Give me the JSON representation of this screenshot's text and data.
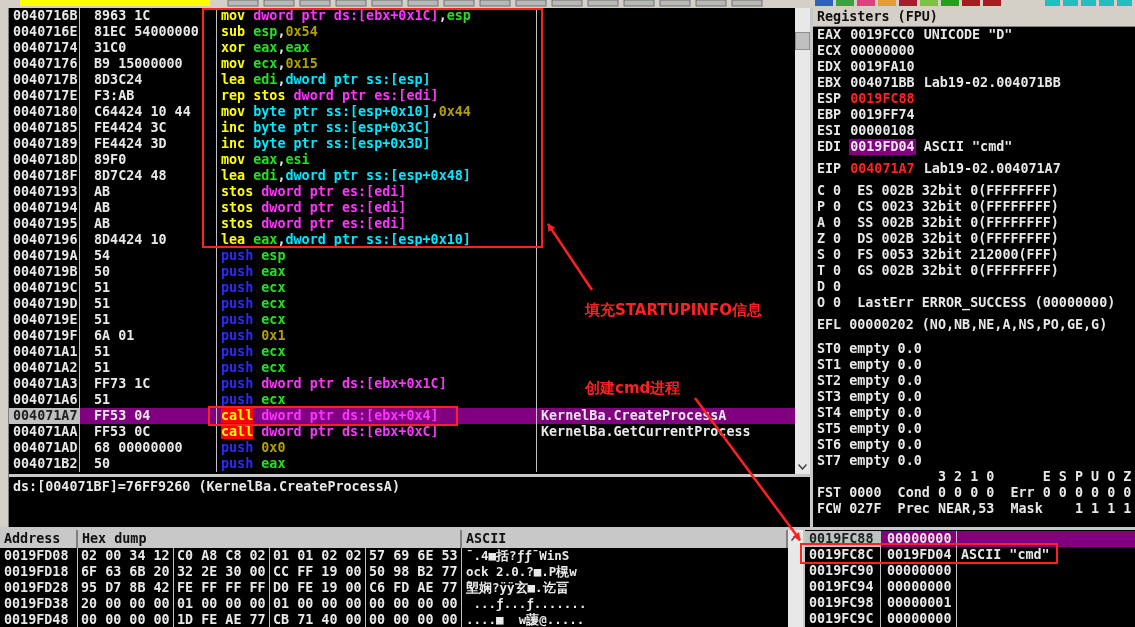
{
  "disassembly": {
    "rows": [
      {
        "address": "0040716B",
        "hex": "8963 1C",
        "op": "mov",
        "kind": "instruction",
        "operands": [
          {
            "text": "dword ptr ds:[ebx+0x1C]",
            "kind": "memory_ds_es"
          },
          {
            "text": ",",
            "kind": "separator"
          },
          {
            "text": "esp",
            "kind": "register"
          }
        ],
        "selected": false
      },
      {
        "address": "0040716E",
        "hex": "81EC 54000000",
        "op": "sub",
        "kind": "instruction",
        "operands": [
          {
            "text": "esp",
            "kind": "register"
          },
          {
            "text": ",",
            "kind": "separator"
          },
          {
            "text": "0x54",
            "kind": "constant"
          }
        ],
        "selected": false
      },
      {
        "address": "00407174",
        "hex": "31C0",
        "op": "xor",
        "kind": "instruction",
        "operands": [
          {
            "text": "eax",
            "kind": "register"
          },
          {
            "text": ",",
            "kind": "separator"
          },
          {
            "text": "eax",
            "kind": "register"
          }
        ],
        "selected": false
      },
      {
        "address": "00407176",
        "hex": "B9 15000000",
        "op": "mov",
        "kind": "instruction",
        "operands": [
          {
            "text": "ecx",
            "kind": "register"
          },
          {
            "text": ",",
            "kind": "separator"
          },
          {
            "text": "0x15",
            "kind": "constant"
          }
        ],
        "selected": false
      },
      {
        "address": "0040717B",
        "hex": "8D3C24",
        "op": "lea",
        "kind": "instruction",
        "operands": [
          {
            "text": "edi",
            "kind": "register"
          },
          {
            "text": ",",
            "kind": "separator"
          },
          {
            "text": "dword ptr ss:[esp]",
            "kind": "memory_ss"
          }
        ],
        "selected": false
      },
      {
        "address": "0040717E",
        "hex": "F3:AB",
        "op": "rep stos",
        "kind": "instruction",
        "operands": [
          {
            "text": "dword ptr es:[edi]",
            "kind": "memory_ds_es"
          }
        ],
        "selected": false
      },
      {
        "address": "00407180",
        "hex": "C64424 10 44",
        "op": "mov",
        "kind": "instruction",
        "operands": [
          {
            "text": "byte ptr ss:[esp+0x10]",
            "kind": "memory_ss"
          },
          {
            "text": ",",
            "kind": "separator"
          },
          {
            "text": "0x44",
            "kind": "constant"
          }
        ],
        "selected": false
      },
      {
        "address": "00407185",
        "hex": "FE4424 3C",
        "op": "inc",
        "kind": "instruction",
        "operands": [
          {
            "text": "byte ptr ss:[esp+0x3C]",
            "kind": "memory_ss"
          }
        ],
        "selected": false
      },
      {
        "address": "00407189",
        "hex": "FE4424 3D",
        "op": "inc",
        "kind": "instruction",
        "operands": [
          {
            "text": "byte ptr ss:[esp+0x3D]",
            "kind": "memory_ss"
          }
        ],
        "selected": false
      },
      {
        "address": "0040718D",
        "hex": "89F0",
        "op": "mov",
        "kind": "instruction",
        "operands": [
          {
            "text": "eax",
            "kind": "register"
          },
          {
            "text": ",",
            "kind": "separator"
          },
          {
            "text": "esi",
            "kind": "register"
          }
        ],
        "selected": false
      },
      {
        "address": "0040718F",
        "hex": "8D7C24 48",
        "op": "lea",
        "kind": "instruction",
        "operands": [
          {
            "text": "edi",
            "kind": "register"
          },
          {
            "text": ",",
            "kind": "separator"
          },
          {
            "text": "dword ptr ss:[esp+0x48]",
            "kind": "memory_ss"
          }
        ],
        "selected": false
      },
      {
        "address": "00407193",
        "hex": "AB",
        "op": "stos",
        "kind": "instruction",
        "operands": [
          {
            "text": "dword ptr es:[edi]",
            "kind": "memory_ds_es"
          }
        ],
        "selected": false
      },
      {
        "address": "00407194",
        "hex": "AB",
        "op": "stos",
        "kind": "instruction",
        "operands": [
          {
            "text": "dword ptr es:[edi]",
            "kind": "memory_ds_es"
          }
        ],
        "selected": false
      },
      {
        "address": "00407195",
        "hex": "AB",
        "op": "stos",
        "kind": "instruction",
        "operands": [
          {
            "text": "dword ptr es:[edi]",
            "kind": "memory_ds_es"
          }
        ],
        "selected": false
      },
      {
        "address": "00407196",
        "hex": "8D4424 10",
        "op": "lea",
        "kind": "instruction",
        "operands": [
          {
            "text": "eax",
            "kind": "register"
          },
          {
            "text": ",",
            "kind": "separator"
          },
          {
            "text": "dword ptr ss:[esp+0x10]",
            "kind": "memory_ss"
          }
        ],
        "selected": false
      },
      {
        "address": "0040719A",
        "hex": "54",
        "op": "push",
        "kind": "stack_push",
        "operands": [
          {
            "text": "esp",
            "kind": "register"
          }
        ],
        "selected": false
      },
      {
        "address": "0040719B",
        "hex": "50",
        "op": "push",
        "kind": "stack_push",
        "operands": [
          {
            "text": "eax",
            "kind": "register"
          }
        ],
        "selected": false
      },
      {
        "address": "0040719C",
        "hex": "51",
        "op": "push",
        "kind": "stack_push",
        "operands": [
          {
            "text": "ecx",
            "kind": "register"
          }
        ],
        "selected": false
      },
      {
        "address": "0040719D",
        "hex": "51",
        "op": "push",
        "kind": "stack_push",
        "operands": [
          {
            "text": "ecx",
            "kind": "register"
          }
        ],
        "selected": false
      },
      {
        "address": "0040719E",
        "hex": "51",
        "op": "push",
        "kind": "stack_push",
        "operands": [
          {
            "text": "ecx",
            "kind": "register"
          }
        ],
        "selected": false
      },
      {
        "address": "0040719F",
        "hex": "6A 01",
        "op": "push",
        "kind": "stack_push",
        "operands": [
          {
            "text": "0x1",
            "kind": "constant"
          }
        ],
        "selected": false
      },
      {
        "address": "004071A1",
        "hex": "51",
        "op": "push",
        "kind": "stack_push",
        "operands": [
          {
            "text": "ecx",
            "kind": "register"
          }
        ],
        "selected": false
      },
      {
        "address": "004071A2",
        "hex": "51",
        "op": "push",
        "kind": "stack_push",
        "operands": [
          {
            "text": "ecx",
            "kind": "register"
          }
        ],
        "selected": false
      },
      {
        "address": "004071A3",
        "hex": "FF73 1C",
        "op": "push",
        "kind": "stack_push",
        "operands": [
          {
            "text": "dword ptr ds:[ebx+0x1C]",
            "kind": "memory_ds_es"
          }
        ],
        "selected": false
      },
      {
        "address": "004071A6",
        "hex": "51",
        "op": "push",
        "kind": "stack_push",
        "operands": [
          {
            "text": "ecx",
            "kind": "register"
          }
        ],
        "selected": false
      },
      {
        "address": "004071A7",
        "hex": "FF53 04",
        "op": "call",
        "kind": "subroutine_call",
        "operands": [
          {
            "text": "dword ptr ds:[ebx+0x4]",
            "kind": "memory_ds_es"
          }
        ],
        "comment": "KernelBa.CreateProcessA",
        "selected": true
      },
      {
        "address": "004071AA",
        "hex": "FF53 0C",
        "op": "call",
        "kind": "subroutine_call",
        "operands": [
          {
            "text": "dword ptr ds:[ebx+0xC]",
            "kind": "memory_ds_es"
          }
        ],
        "comment": "KernelBa.GetCurrentProcess",
        "selected": false
      },
      {
        "address": "004071AD",
        "hex": "68 00000000",
        "op": "push",
        "kind": "stack_push",
        "operands": [
          {
            "text": "0x0",
            "kind": "constant"
          }
        ],
        "selected": false
      },
      {
        "address": "004071B2",
        "hex": "50",
        "op": "push",
        "kind": "stack_push",
        "operands": [
          {
            "text": "eax",
            "kind": "register"
          }
        ],
        "selected": false
      }
    ]
  },
  "info_line": "ds:[004071BF]=76FF9260 (KernelBa.CreateProcessA)",
  "registers": {
    "title": "Registers (FPU)",
    "groups": [
      [
        {
          "kind": "reg",
          "name": "EAX",
          "value": "0019FCC0",
          "changed": false,
          "highlighted": false,
          "comment": "UNICODE \"D\""
        },
        {
          "kind": "reg",
          "name": "ECX",
          "value": "00000000",
          "changed": false,
          "highlighted": false
        },
        {
          "kind": "reg",
          "name": "EDX",
          "value": "0019FA10",
          "changed": false,
          "highlighted": false
        },
        {
          "kind": "reg",
          "name": "EBX",
          "value": "004071BB",
          "changed": false,
          "highlighted": false,
          "comment": "Lab19-02.004071BB"
        },
        {
          "kind": "reg",
          "name": "ESP",
          "value": "0019FC88",
          "changed": true,
          "highlighted": false
        },
        {
          "kind": "reg",
          "name": "EBP",
          "value": "0019FF74",
          "changed": false,
          "highlighted": false
        },
        {
          "kind": "reg",
          "name": "ESI",
          "value": "00000108",
          "changed": false,
          "highlighted": false
        },
        {
          "kind": "reg",
          "name": "EDI",
          "value": "0019FD04",
          "changed": false,
          "highlighted": true,
          "comment": "ASCII \"cmd\""
        }
      ],
      [
        {
          "kind": "reg",
          "name": "EIP",
          "value": "004071A7",
          "changed": true,
          "highlighted": false,
          "comment": "Lab19-02.004071A7"
        }
      ],
      [
        {
          "kind": "text",
          "text": "C 0  ES 002B 32bit 0(FFFFFFFF)"
        },
        {
          "kind": "text",
          "text": "P 0  CS 0023 32bit 0(FFFFFFFF)"
        },
        {
          "kind": "text",
          "text": "A 0  SS 002B 32bit 0(FFFFFFFF)"
        },
        {
          "kind": "text",
          "text": "Z 0  DS 002B 32bit 0(FFFFFFFF)"
        },
        {
          "kind": "text",
          "text": "S 0  FS 0053 32bit 212000(FFF)"
        },
        {
          "kind": "text",
          "text": "T 0  GS 002B 32bit 0(FFFFFFFF)"
        },
        {
          "kind": "text",
          "text": "D 0"
        },
        {
          "kind": "text",
          "text": "O 0  LastErr ERROR_SUCCESS (00000000)"
        }
      ],
      [
        {
          "kind": "text",
          "text": "EFL 00000202 (NO,NB,NE,A,NS,PO,GE,G)"
        }
      ],
      [
        {
          "kind": "text",
          "text": "ST0 empty 0.0"
        },
        {
          "kind": "text",
          "text": "ST1 empty 0.0"
        },
        {
          "kind": "text",
          "text": "ST2 empty 0.0"
        },
        {
          "kind": "text",
          "text": "ST3 empty 0.0"
        },
        {
          "kind": "text",
          "text": "ST4 empty 0.0"
        },
        {
          "kind": "text",
          "text": "ST5 empty 0.0"
        },
        {
          "kind": "text",
          "text": "ST6 empty 0.0"
        },
        {
          "kind": "text",
          "text": "ST7 empty 0.0"
        },
        {
          "kind": "text",
          "text": "               3 2 1 0      E S P U O Z"
        },
        {
          "kind": "text",
          "text": "FST 0000  Cond 0 0 0 0  Err 0 0 0 0 0 0"
        },
        {
          "kind": "text",
          "text": "FCW 027F  Prec NEAR,53  Mask    1 1 1 1"
        }
      ]
    ]
  },
  "dump": {
    "columns": [
      "Address",
      "Hex dump",
      "ASCII"
    ],
    "rows": [
      {
        "address": "0019FD08",
        "hex": [
          "02 00 34 12",
          "C0 A8 C8 02",
          "01 01 02 02",
          "57 69 6E 53"
        ],
        "ascii": "ˉ.4■括?ƒƒˉWinS"
      },
      {
        "address": "0019FD18",
        "hex": [
          "6F 63 6B 20",
          "32 2E 30 00",
          "CC FF 19 00",
          "50 98 B2 77"
        ],
        "ascii": "ock 2.0.?■.P榥w"
      },
      {
        "address": "0019FD28",
        "hex": [
          "95 D7 8B 42",
          "FE FF FF FF",
          "D0 FE 19 00",
          "C6 FD AE 77"
        ],
        "ascii": "塱娴?ÿÿ玄■.讫畐"
      },
      {
        "address": "0019FD38",
        "hex": [
          "20 00 00 00",
          "01 00 00 00",
          "01 00 00 00",
          "00 00 00 00"
        ],
        "ascii": " ...ƒ...ƒ......."
      },
      {
        "address": "0019FD48",
        "hex": [
          "00 00 00 00",
          "1D FE AE 77",
          "CB 71 40 00",
          "00 00 00 00"
        ],
        "ascii": "....■  w蘐@....."
      }
    ]
  },
  "stack": {
    "rows": [
      {
        "address": "0019FC88",
        "value": "00000000",
        "selected": true
      },
      {
        "address": "0019FC8C",
        "value": "0019FD04",
        "comment": "ASCII \"cmd\"",
        "selected": false
      },
      {
        "address": "0019FC90",
        "value": "00000000",
        "selected": false
      },
      {
        "address": "0019FC94",
        "value": "00000000",
        "selected": false
      },
      {
        "address": "0019FC98",
        "value": "00000001",
        "selected": false
      },
      {
        "address": "0019FC9C",
        "value": "00000000",
        "selected": false
      }
    ]
  },
  "annotations": {
    "labels": [
      {
        "text": "填充STARTUPINFO信息"
      },
      {
        "text": "创建cmd进程"
      }
    ]
  }
}
